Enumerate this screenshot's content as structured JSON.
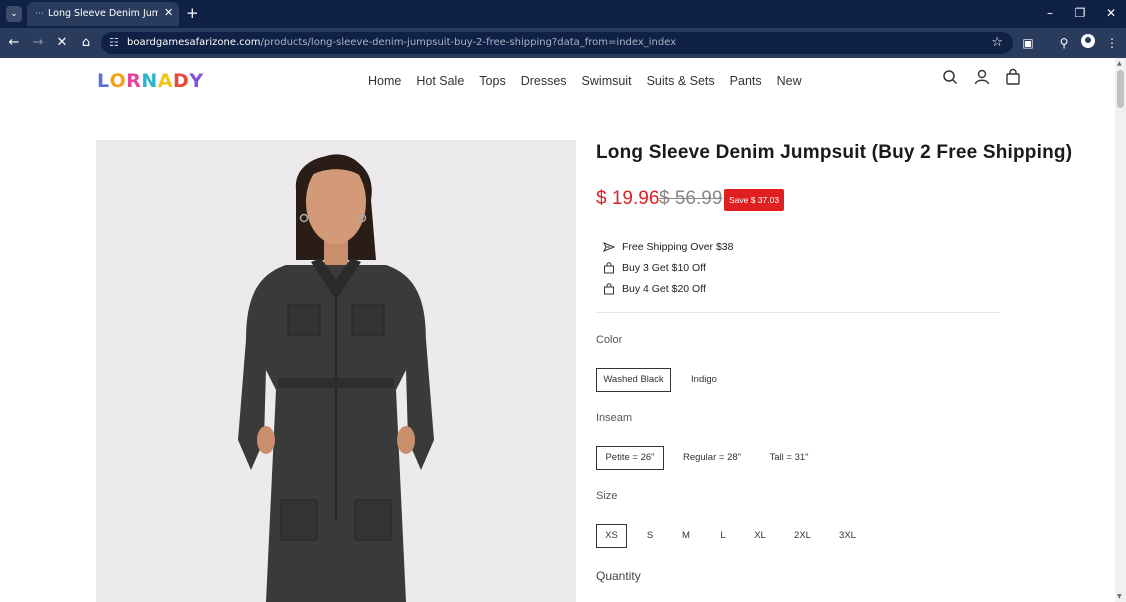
{
  "browser": {
    "tab_title": "Long Sleeve Denim Jumpsuit (B",
    "url_host": "boardgamesafarizone.com",
    "url_path": "/products/long-sleeve-denim-jumpsuit-buy-2-free-shipping?data_from=index_index"
  },
  "header": {
    "logo_letters": [
      "L",
      "O",
      "R",
      "N",
      "A",
      "D",
      "Y"
    ],
    "logo_colors": [
      "#5b6fe0",
      "#f3a11a",
      "#e6449a",
      "#27b7c9",
      "#f0c419",
      "#e64b3c",
      "#8a4fd8"
    ],
    "nav": [
      "Home",
      "Hot Sale",
      "Tops",
      "Dresses",
      "Swimsuit",
      "Suits & Sets",
      "Pants",
      "New"
    ]
  },
  "product": {
    "title": "Long Sleeve Denim Jumpsuit (Buy 2 Free Shipping)",
    "price": "$ 19.96",
    "old_price": "$ 56.99",
    "save_badge": "Save $ 37.03",
    "perks": [
      {
        "icon": "shipping-icon",
        "text": "Free Shipping Over $38"
      },
      {
        "icon": "bag-icon",
        "text": "Buy 3 Get $10 Off"
      },
      {
        "icon": "bag-icon",
        "text": "Buy 4 Get $20 Off"
      }
    ],
    "color_label": "Color",
    "colors": [
      "Washed Black",
      "Indigo"
    ],
    "selected_color": "Washed Black",
    "inseam_label": "Inseam",
    "inseams": [
      "Petite = 26\"",
      "Regular = 28\"",
      "Tall = 31\""
    ],
    "selected_inseam": "Petite = 26\"",
    "size_label": "Size",
    "sizes": [
      "XS",
      "S",
      "M",
      "L",
      "XL",
      "2XL",
      "3XL"
    ],
    "selected_size": "XS",
    "quantity_label": "Quantity"
  }
}
